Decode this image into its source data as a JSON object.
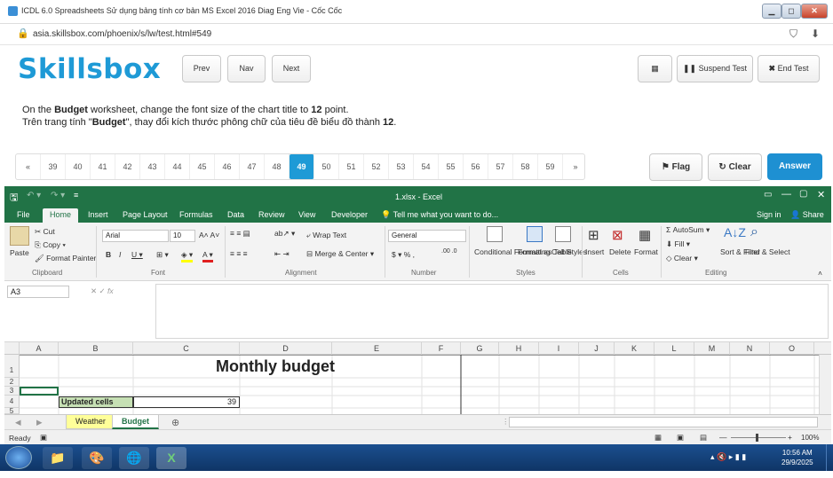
{
  "browser": {
    "title": "ICDL 6.0 Spreadsheets Sử dụng bảng tính cơ bản MS Excel 2016 Diag Eng Vie - Cốc Cốc",
    "url": "asia.skillsbox.com/phoenix/s/lw/test.html#549"
  },
  "app": {
    "logo": "Skillsbox",
    "prev": "Prev",
    "nav": "Nav",
    "next": "Next",
    "suspend": "Suspend Test",
    "end": "End Test"
  },
  "instructions": {
    "en_prefix": "On the ",
    "en_bold1": "Budget",
    "en_mid": " worksheet, change the font size of the chart title to ",
    "en_bold2": "12",
    "en_suffix": " point.",
    "vi_prefix": "Trên trang tính \"",
    "vi_bold1": "Budget",
    "vi_mid": "\", thay đổi kích thước phông chữ của tiêu đề biểu đồ thành ",
    "vi_bold2": "12",
    "vi_suffix": "."
  },
  "question_nav": {
    "first": "«",
    "last": "»",
    "numbers": [
      "39",
      "40",
      "41",
      "42",
      "43",
      "44",
      "45",
      "46",
      "47",
      "48",
      "49",
      "50",
      "51",
      "52",
      "53",
      "54",
      "55",
      "56",
      "57",
      "58",
      "59"
    ],
    "current": "49",
    "flag": "Flag",
    "clear": "Clear",
    "answer": "Answer"
  },
  "excel": {
    "filename": "1.xlsx - Excel",
    "tabs": [
      "File",
      "Home",
      "Insert",
      "Page Layout",
      "Formulas",
      "Data",
      "Review",
      "View",
      "Developer"
    ],
    "active_tab": "Home",
    "tell_me": "Tell me what you want to do...",
    "sign_in": "Sign in",
    "share": "Share",
    "ribbon": {
      "paste": "Paste",
      "cut": "Cut",
      "copy": "Copy",
      "format_painter": "Format Painter",
      "font_name": "Arial",
      "font_size": "10",
      "wrap_text": "Wrap Text",
      "merge_center": "Merge & Center",
      "number_format": "General",
      "conditional_formatting": "Conditional Formatting",
      "format_as_table": "Format as Table",
      "cell_styles": "Cell Styles",
      "insert": "Insert",
      "delete": "Delete",
      "format": "Format",
      "autosum": "AutoSum",
      "fill": "Fill",
      "clear": "Clear",
      "sort_filter": "Sort & Filter",
      "find_select": "Find & Select",
      "groups": [
        "Clipboard",
        "Font",
        "Alignment",
        "Number",
        "Styles",
        "Cells",
        "Editing"
      ]
    },
    "name_box": "A3",
    "columns": [
      "A",
      "B",
      "C",
      "D",
      "E",
      "F",
      "G",
      "H",
      "I",
      "J",
      "K",
      "L",
      "M",
      "N",
      "O"
    ],
    "rows": [
      "1",
      "2",
      "3",
      "4",
      "5"
    ],
    "cells": {
      "title": "Monthly budget",
      "updated_label": "Updated cells",
      "updated_value": "39"
    },
    "sheets": [
      "Weather",
      "Budget"
    ],
    "active_sheet": "Budget",
    "status": "Ready",
    "zoom": "100%"
  },
  "taskbar": {
    "time": "10:56 AM",
    "date": "29/9/2025"
  }
}
